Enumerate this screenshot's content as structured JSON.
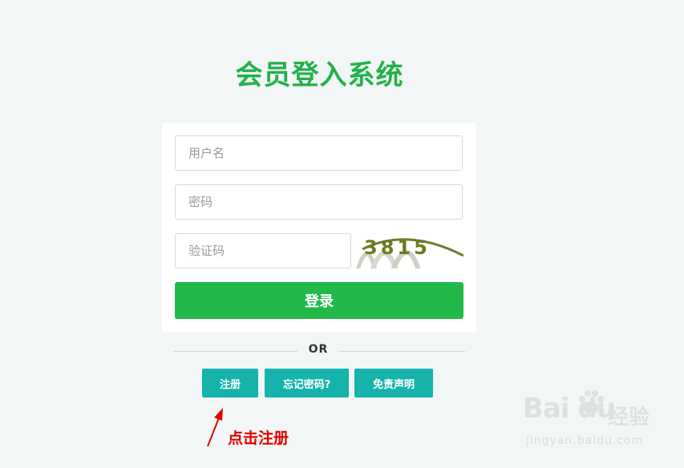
{
  "page": {
    "title": "会员登入系统"
  },
  "form": {
    "username_placeholder": "用户名",
    "password_placeholder": "密码",
    "captcha_placeholder": "验证码",
    "captcha_text": "3815",
    "login_label": "登录"
  },
  "divider": {
    "label": "OR"
  },
  "links": {
    "register": "注册",
    "forgot_password": "忘记密码?",
    "disclaimer": "免责声明"
  },
  "annotation": {
    "text": "点击注册",
    "color": "#e00000"
  },
  "watermark": {
    "brand": "Bai du",
    "cn": "经验",
    "url": "jingyan.baidu.com"
  },
  "colors": {
    "title": "#21b24a",
    "login_button": "#22b94a",
    "link_button": "#15b3ac"
  }
}
